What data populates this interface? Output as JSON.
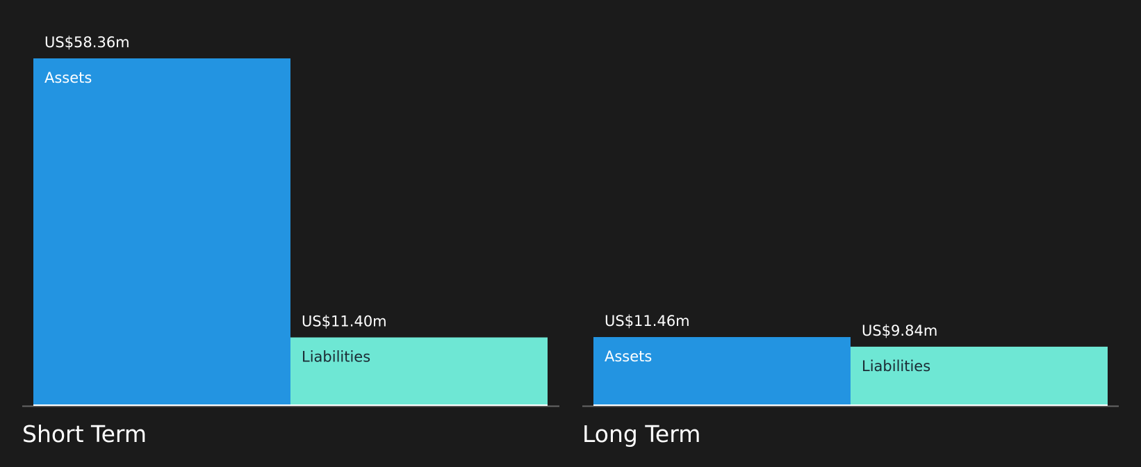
{
  "colors": {
    "background": "#1b1b1b",
    "assets": "#2394e1",
    "liabilities": "#6ee7d4",
    "axis": "#666666",
    "baseline": "#ffffff",
    "value_text": "#ffffff",
    "assets_label_text": "#ffffff",
    "liabilities_label_text": "#1b2a33",
    "group_label_text": "#ffffff"
  },
  "chart_data": {
    "type": "bar",
    "unit": "US$m",
    "ylim": [
      0,
      58.36
    ],
    "grid": false,
    "legend": "none",
    "groups": [
      {
        "name": "Short Term",
        "bars": [
          {
            "label": "Assets",
            "value": 58.36,
            "value_label": "US$58.36m",
            "color": "#2394e1"
          },
          {
            "label": "Liabilities",
            "value": 11.4,
            "value_label": "US$11.40m",
            "color": "#6ee7d4"
          }
        ]
      },
      {
        "name": "Long Term",
        "bars": [
          {
            "label": "Assets",
            "value": 11.46,
            "value_label": "US$11.46m",
            "color": "#2394e1"
          },
          {
            "label": "Liabilities",
            "value": 9.84,
            "value_label": "US$9.84m",
            "color": "#6ee7d4"
          }
        ]
      }
    ]
  }
}
